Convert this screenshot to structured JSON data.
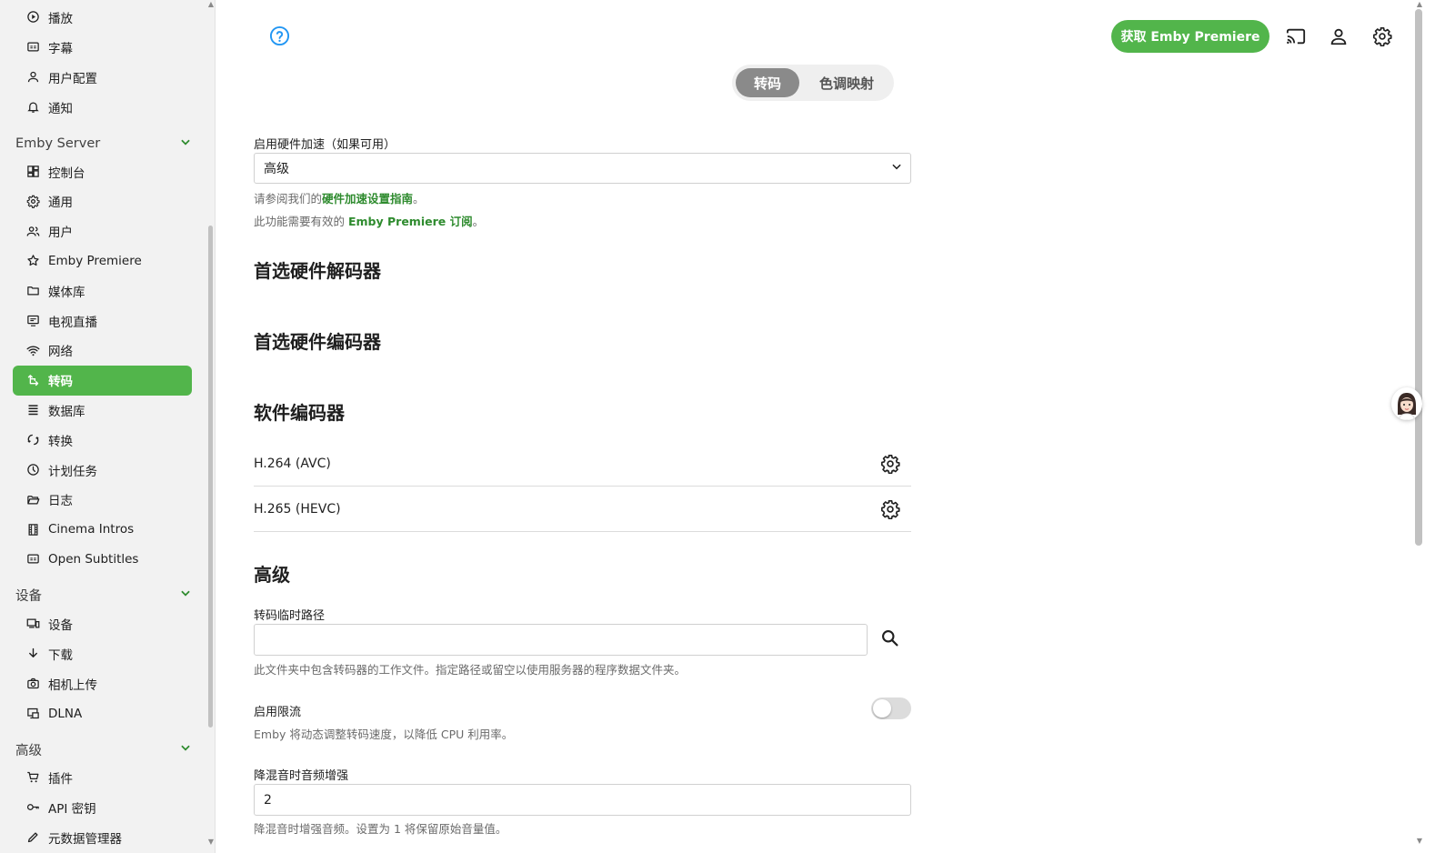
{
  "sidebar": {
    "items_top": [
      {
        "label": "播放",
        "icon": "play-circle-icon"
      },
      {
        "label": "字幕",
        "icon": "subtitles-icon"
      },
      {
        "label": "用户配置",
        "icon": "user-icon"
      },
      {
        "label": "通知",
        "icon": "bell-icon"
      }
    ],
    "section_server": "Emby Server",
    "items_server": [
      {
        "label": "控制台",
        "icon": "dashboard-icon"
      },
      {
        "label": "通用",
        "icon": "gear-icon"
      },
      {
        "label": "用户",
        "icon": "users-icon"
      },
      {
        "label": "Emby Premiere",
        "icon": "star-icon"
      },
      {
        "label": "媒体库",
        "icon": "folder-icon"
      },
      {
        "label": "电视直播",
        "icon": "tv-icon"
      },
      {
        "label": "网络",
        "icon": "wifi-icon"
      },
      {
        "label": "转码",
        "icon": "transcode-icon",
        "active": true
      },
      {
        "label": "数据库",
        "icon": "database-icon"
      },
      {
        "label": "转换",
        "icon": "convert-icon"
      },
      {
        "label": "计划任务",
        "icon": "clock-icon"
      },
      {
        "label": "日志",
        "icon": "folder-open-icon"
      },
      {
        "label": "Cinema Intros",
        "icon": "film-icon"
      },
      {
        "label": "Open Subtitles",
        "icon": "subtitles-icon"
      }
    ],
    "section_devices": "设备",
    "items_devices": [
      {
        "label": "设备",
        "icon": "devices-icon"
      },
      {
        "label": "下载",
        "icon": "download-icon"
      },
      {
        "label": "相机上传",
        "icon": "camera-icon"
      },
      {
        "label": "DLNA",
        "icon": "dlna-icon"
      }
    ],
    "section_advanced": "高级",
    "items_advanced": [
      {
        "label": "插件",
        "icon": "cart-icon"
      },
      {
        "label": "API 密钥",
        "icon": "key-icon"
      },
      {
        "label": "元数据管理器",
        "icon": "pencil-icon"
      }
    ]
  },
  "header": {
    "premiere_button": "获取 Emby Premiere",
    "accent_color": "#52b54b"
  },
  "tabs": {
    "transcode": "转码",
    "tonemap": "色调映射"
  },
  "form": {
    "hwaccel_label": "启用硬件加速（如果可用）",
    "hwaccel_value": "高级",
    "hwaccel_hint_prefix": "请参阅我们的",
    "hwaccel_hint_link": "硬件加速设置指南",
    "hwaccel_hint_suffix": "。",
    "premiere_hint_prefix": "此功能需要有效的 ",
    "premiere_hint_link": "Emby Premiere 订阅",
    "premiere_hint_suffix": "。",
    "section_decoders": "首选硬件解码器",
    "section_encoders": "首选硬件编码器",
    "section_software": "软件编码器",
    "codecs": [
      "H.264 (AVC)",
      "H.265 (HEVC)"
    ],
    "section_advanced": "高级",
    "temp_path_label": "转码临时路径",
    "temp_path_value": "",
    "temp_path_hint": "此文件夹中包含转码器的工作文件。指定路径或留空以使用服务器的程序数据文件夹。",
    "throttle_label": "启用限流",
    "throttle_enabled": false,
    "throttle_hint": "Emby 将动态调整转码速度，以降低 CPU 利用率。",
    "downmix_label": "降混音时音频增强",
    "downmix_value": "2",
    "downmix_hint": "降混音时增强音频。设置为 1 将保留原始音量值。"
  }
}
